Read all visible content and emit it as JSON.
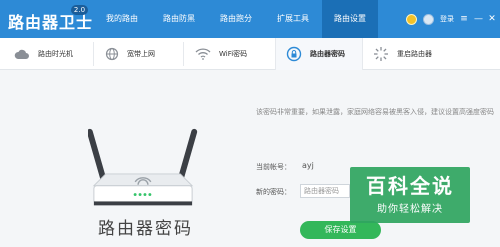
{
  "app": {
    "title": "路由器卫士",
    "version": "2.0"
  },
  "nav": {
    "items": [
      {
        "label": "我的路由"
      },
      {
        "label": "路由防黑"
      },
      {
        "label": "路由跑分"
      },
      {
        "label": "扩展工具"
      },
      {
        "label": "路由设置",
        "active": true
      }
    ]
  },
  "header_right": {
    "login_label": "登录",
    "menu_icon": "≡",
    "minimize_icon": "—",
    "close_icon": "✕"
  },
  "subnav": {
    "items": [
      {
        "label": "路由时光机",
        "icon": "cloud-icon"
      },
      {
        "label": "宽带上网",
        "icon": "globe-icon"
      },
      {
        "label": "WiFi密码",
        "icon": "wifi-icon"
      },
      {
        "label": "路由器密码",
        "icon": "lock-icon",
        "active": true
      },
      {
        "label": "重启路由器",
        "icon": "restart-icon"
      }
    ]
  },
  "main": {
    "title": "路由器密码",
    "description": "该密码非常重要，如果泄露，家庭网络容易被黑客入侵，建议设置高强度密码",
    "account_label": "当前帐号：",
    "account_value": "ayj",
    "new_password_label": "新的密码：",
    "password_placeholder": "路由器密码",
    "save_label": "保存设置"
  },
  "watermark": {
    "title": "百科全说",
    "subtitle": "助你轻松解决"
  },
  "colors": {
    "topbar": "#2d8ad6",
    "topbar_active": "#1b6fb6",
    "save_button": "#33b75a"
  }
}
